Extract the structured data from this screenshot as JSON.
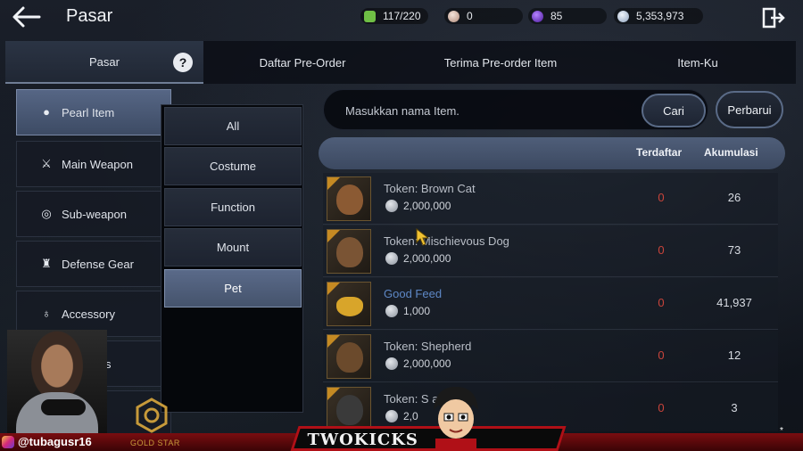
{
  "header": {
    "title": "Pasar",
    "resources": [
      {
        "icon": "energy-icon",
        "value": "117/220",
        "color": "#6fbf45"
      },
      {
        "icon": "pearl-icon",
        "value": "0",
        "color": "#d9b7a5"
      },
      {
        "icon": "purple-gem-icon",
        "value": "85",
        "color": "#8a45d8"
      },
      {
        "icon": "silver-coin-icon",
        "value": "5,353,973",
        "color": "#c9d6e8"
      }
    ]
  },
  "tabs": [
    {
      "label": "Pasar",
      "active": true
    },
    {
      "label": "Daftar Pre-Order"
    },
    {
      "label": "Terima Pre-order Item"
    },
    {
      "label": "Item-Ku"
    }
  ],
  "help_label": "?",
  "categories": [
    {
      "label": "Pearl Item",
      "icon": "pearl-icon",
      "glyph": "●",
      "active": true
    },
    {
      "label": "Main Weapon",
      "icon": "crossed-swords-icon",
      "glyph": "⚔"
    },
    {
      "label": "Sub-weapon",
      "icon": "shield-ring-icon",
      "glyph": "◎"
    },
    {
      "label": "Defense Gear",
      "icon": "armor-icon",
      "glyph": "♜"
    },
    {
      "label": "Accessory",
      "icon": "ring-icon",
      "glyph": "♁"
    },
    {
      "label": "ials",
      "icon": "materials-icon",
      "glyph": ""
    }
  ],
  "subcategories": [
    {
      "label": "All"
    },
    {
      "label": "Costume"
    },
    {
      "label": "Function"
    },
    {
      "label": "Mount"
    },
    {
      "label": "Pet",
      "active": true
    }
  ],
  "search": {
    "placeholder": "Masukkan nama Item.",
    "button": "Cari",
    "refresh": "Perbarui"
  },
  "table": {
    "col_registered": "Terdaftar",
    "col_accumulated": "Akumulasi",
    "rows": [
      {
        "name": "Token: Brown Cat",
        "price": "2,000,000",
        "registered": "0",
        "accumulated": "26",
        "color": "#8b5a33",
        "highlight": false
      },
      {
        "name": "Token: Mischievous Dog",
        "price": "2,000,000",
        "registered": "0",
        "accumulated": "73",
        "color": "#7a5434",
        "highlight": false
      },
      {
        "name": "Good Feed",
        "price": "1,000",
        "registered": "0",
        "accumulated": "41,937",
        "color": "#d8a52a",
        "highlight": true
      },
      {
        "name": "Token: Shepherd",
        "price": "2,000,000",
        "registered": "0",
        "accumulated": "12",
        "color": "#6b4a2c",
        "highlight": false
      },
      {
        "name": "Token: S     ack Cat",
        "price": "2,0",
        "registered": "0",
        "accumulated": "3",
        "color": "#3a3a3a",
        "highlight": false
      }
    ]
  },
  "overlay": {
    "handle": "@tubagusr16",
    "brand": "GOLD STAR",
    "plate": "TWOKICKS",
    "star": "*"
  }
}
